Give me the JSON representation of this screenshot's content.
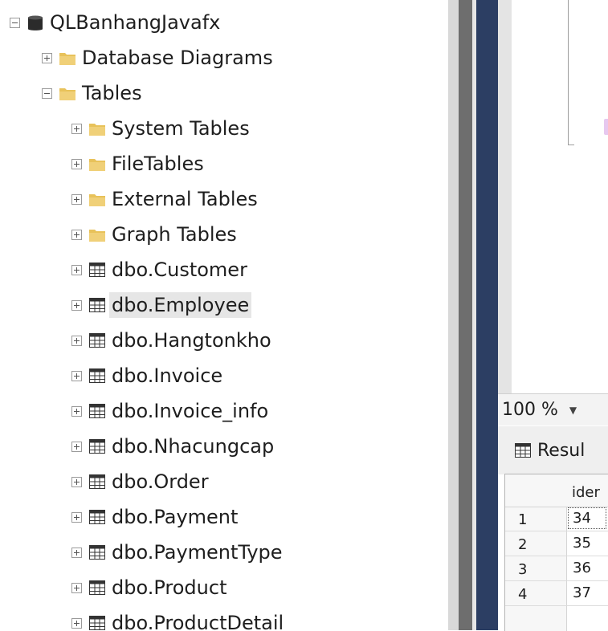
{
  "tree": {
    "database": {
      "label": "QLBanhangJavafx",
      "expanded": true
    },
    "items": [
      {
        "label": "Database Diagrams",
        "icon": "folder-icon",
        "expanded": false,
        "level": 1
      },
      {
        "label": "Tables",
        "icon": "folder-icon",
        "expanded": true,
        "level": 1
      },
      {
        "label": "System Tables",
        "icon": "folder-icon",
        "expanded": false,
        "level": 2
      },
      {
        "label": "FileTables",
        "icon": "folder-icon",
        "expanded": false,
        "level": 2
      },
      {
        "label": "External Tables",
        "icon": "folder-icon",
        "expanded": false,
        "level": 2
      },
      {
        "label": "Graph Tables",
        "icon": "folder-icon",
        "expanded": false,
        "level": 2
      },
      {
        "label": "dbo.Customer",
        "icon": "table-icon",
        "expanded": false,
        "level": 2
      },
      {
        "label": "dbo.Employee",
        "icon": "table-icon",
        "expanded": false,
        "level": 2,
        "selected": true
      },
      {
        "label": "dbo.Hangtonkho",
        "icon": "table-icon",
        "expanded": false,
        "level": 2
      },
      {
        "label": "dbo.Invoice",
        "icon": "table-icon",
        "expanded": false,
        "level": 2
      },
      {
        "label": "dbo.Invoice_info",
        "icon": "table-icon",
        "expanded": false,
        "level": 2
      },
      {
        "label": "dbo.Nhacungcap",
        "icon": "table-icon",
        "expanded": false,
        "level": 2
      },
      {
        "label": "dbo.Order",
        "icon": "table-icon",
        "expanded": false,
        "level": 2
      },
      {
        "label": "dbo.Payment",
        "icon": "table-icon",
        "expanded": false,
        "level": 2
      },
      {
        "label": "dbo.PaymentType",
        "icon": "table-icon",
        "expanded": false,
        "level": 2
      },
      {
        "label": "dbo.Product",
        "icon": "table-icon",
        "expanded": false,
        "level": 2
      },
      {
        "label": "dbo.ProductDetail",
        "icon": "table-icon",
        "expanded": false,
        "level": 2
      }
    ]
  },
  "zoom": {
    "value": "100 %"
  },
  "results": {
    "tab_label": "Resul",
    "column_header": "ider",
    "rows": [
      {
        "row": "1",
        "value": "34"
      },
      {
        "row": "2",
        "value": "35"
      },
      {
        "row": "3",
        "value": "36"
      },
      {
        "row": "4",
        "value": "37"
      }
    ]
  },
  "colors": {
    "folder": "#e8c25a",
    "database": "#2b2b2b",
    "splitter_dark": "#2c3e63",
    "selection": "#e6e6e6"
  }
}
